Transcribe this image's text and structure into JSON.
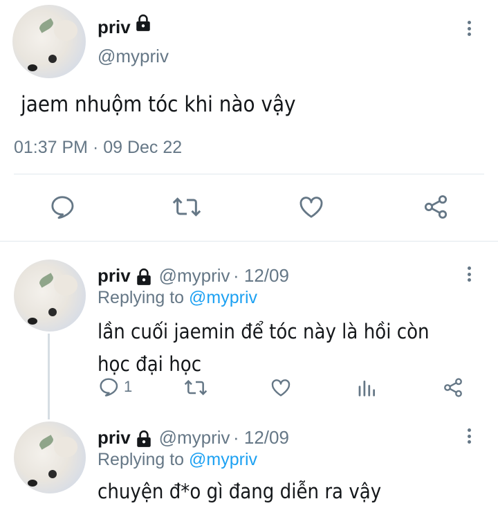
{
  "main_tweet": {
    "name": "priv",
    "handle": "@mypriv",
    "text": "jaem nhuộm tóc khi nào vậy",
    "timestamp": "01:37 PM · 09 Dec 22",
    "actions": [
      "reply-icon",
      "retweet-icon",
      "like-icon",
      "share-icon"
    ]
  },
  "replies": [
    {
      "name": "priv",
      "handle": "@mypriv",
      "date": "· 12/09",
      "replying_prefix": "Replying to",
      "replying_to": "@mypriv",
      "text": "lần cuối jaemin để tóc này là hồi còn học đại học",
      "reply_count": "1"
    },
    {
      "name": "priv",
      "handle": "@mypriv",
      "date": "· 12/09",
      "replying_prefix": "Replying to",
      "replying_to": "@mypriv",
      "text": "chuyện đ*o gì đang diễn ra vậy"
    }
  ],
  "colors": {
    "text": "#14171a",
    "secondary": "#657786",
    "link": "#1da1f2",
    "divider": "#e1e8ed"
  }
}
